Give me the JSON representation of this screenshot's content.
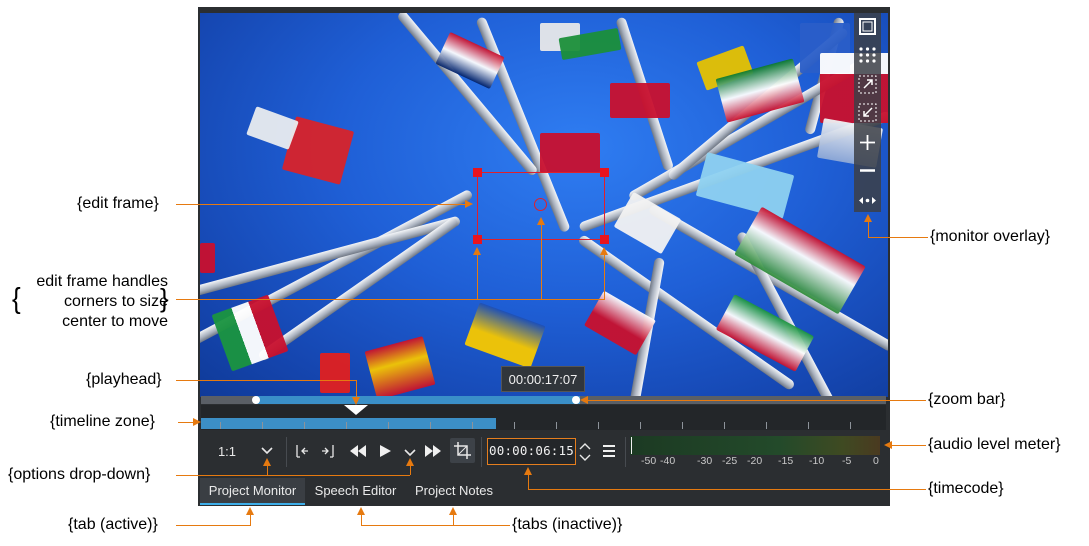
{
  "annotations": {
    "edit_frame": "{edit frame}",
    "handles_line1": "edit frame handles",
    "handles_line2": "corners to size",
    "handles_line3": "center to move",
    "playhead": "{playhead}",
    "timeline_zone": "{timeline zone}",
    "options_dropdown": "{options drop-down}",
    "tab_active": "{tab (active)}",
    "tabs_inactive": "{tabs (inactive)}",
    "monitor_overlay": "{monitor overlay}",
    "zoom_bar": "{zoom bar}",
    "audio_level_meter": "{audio level meter}",
    "timecode": "{timecode}"
  },
  "monitor": {
    "tooltip_time": "00:00:17:07",
    "zoom_value": "1:1",
    "timecode": "00:00:06:15",
    "meter_labels": [
      "-50",
      "-40",
      "-30",
      "-25",
      "-20",
      "-15",
      "-10",
      "-5",
      "0"
    ]
  },
  "tabs": [
    {
      "label": "Project Monitor",
      "active": true
    },
    {
      "label": "Speech Editor",
      "active": false
    },
    {
      "label": "Project Notes",
      "active": false
    }
  ],
  "colors": {
    "accent": "#e67a10",
    "tab_highlight": "#3daee9",
    "edit_frame": "#e0202a"
  }
}
